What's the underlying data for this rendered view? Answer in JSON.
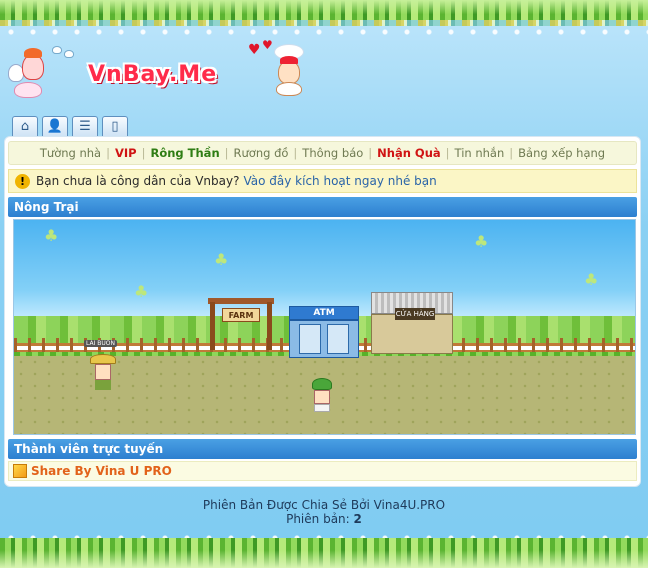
{
  "header": {
    "logo_text": "VnBay.Me",
    "icon_tabs": [
      "home-icon",
      "profile-icon",
      "list-icon",
      "door-icon"
    ]
  },
  "nav": {
    "items": [
      {
        "label": "Tường nhà",
        "style": "normal"
      },
      {
        "label": "VIP",
        "style": "red"
      },
      {
        "label": "Rông Thần",
        "style": "green"
      },
      {
        "label": "Rương đồ",
        "style": "normal"
      },
      {
        "label": "Thông báo",
        "style": "normal"
      },
      {
        "label": "Nhận Quà",
        "style": "red"
      },
      {
        "label": "Tin nhắn",
        "style": "normal"
      },
      {
        "label": "Bảng xếp hạng",
        "style": "normal"
      }
    ]
  },
  "notice": {
    "text": "Bạn chưa là công dân của Vnbay?",
    "link": "Vào đây kích hoạt ngay nhé bạn",
    "icon": "!"
  },
  "farm": {
    "title": "Nông Trại",
    "sign": "FARM",
    "atm": "ATM",
    "shop": "CỬA HÀNG",
    "npc_name": "LAI BUON"
  },
  "online": {
    "title": "Thành viên trực tuyến",
    "member": "Share By Vina U PRO"
  },
  "footer": {
    "line1": "Phiên Bản Được Chia Sẻ Bởi Vina4U.PRO",
    "version_label": "Phiên bản:",
    "version_value": "2"
  },
  "colors": {
    "section_header": "#2d7fcf",
    "nav_bg": "#f6f7dc",
    "logo": "#ff2b4a",
    "link_orange": "#e2621a"
  }
}
